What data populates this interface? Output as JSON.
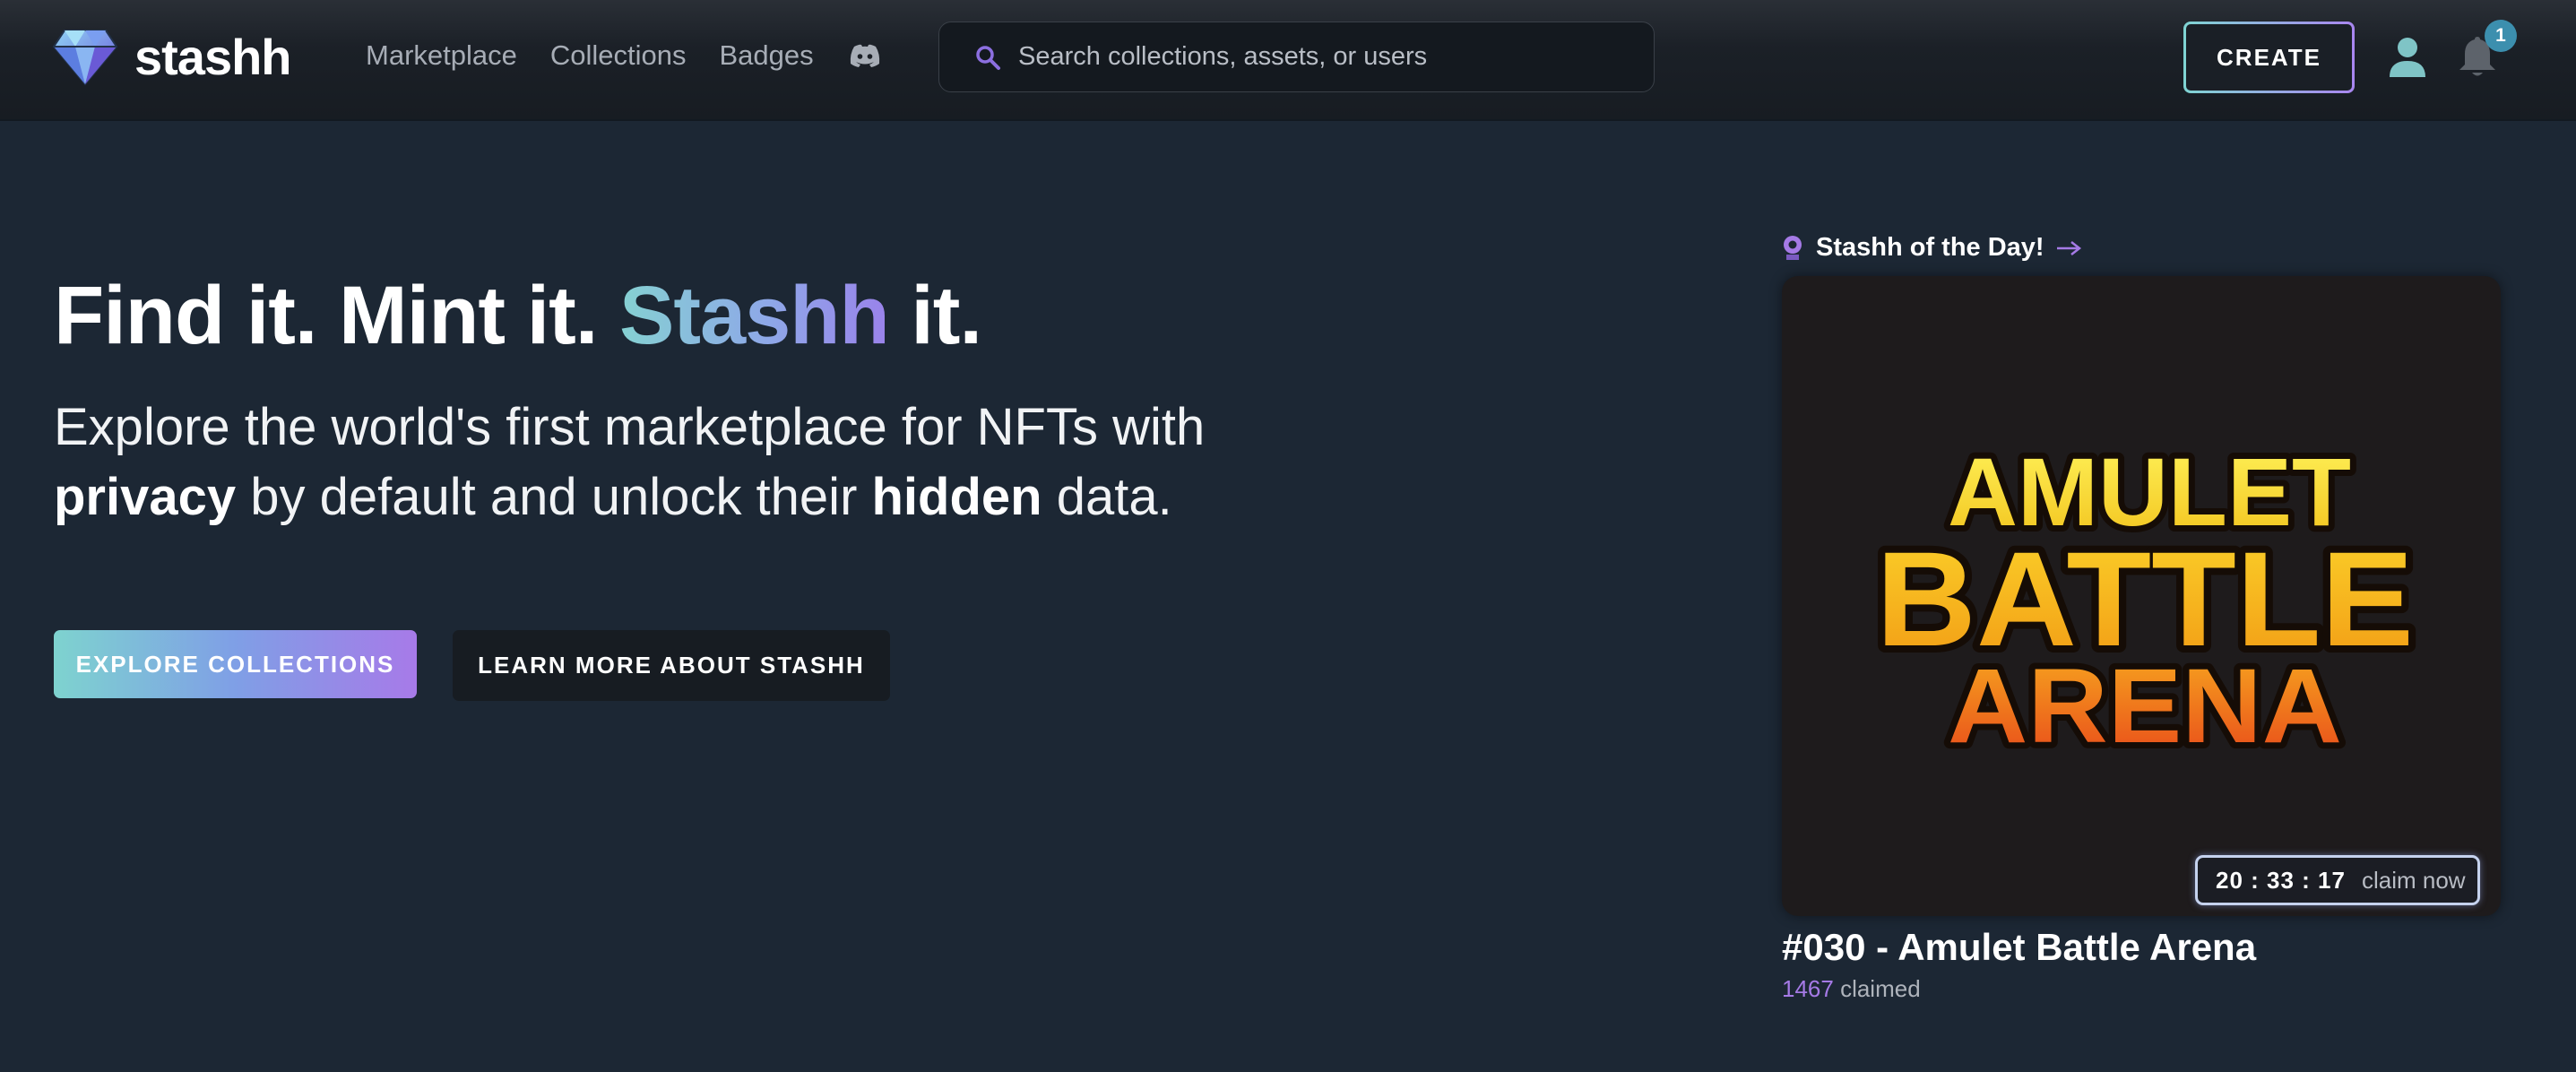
{
  "brand": {
    "name": "stashh"
  },
  "nav": {
    "items": [
      "Marketplace",
      "Collections",
      "Badges"
    ]
  },
  "search": {
    "placeholder": "Search collections, assets, or users"
  },
  "header": {
    "create_label": "CREATE",
    "notification_count": "1"
  },
  "hero": {
    "title_part1": "Find it. Mint it. ",
    "title_highlight": "Stashh",
    "title_part2": " it.",
    "subtitle_part1": "Explore the world's first marketplace for NFTs with ",
    "subtitle_bold1": "privacy",
    "subtitle_part2": " by default and unlock their ",
    "subtitle_bold2": "hidden",
    "subtitle_part3": " data.",
    "explore_label": "EXPLORE COLLECTIONS",
    "learn_label": "LEARN MORE ABOUT STASHH"
  },
  "sotd": {
    "heading": "Stashh of the Day!",
    "art_lines": [
      "AMULET",
      "BATTLE",
      "ARENA"
    ],
    "timer": "20 : 33 : 17",
    "claim_label": "claim now",
    "title": "#030 - Amulet Battle Arena",
    "claimed_count": "1467",
    "claimed_label": " claimed"
  },
  "colors": {
    "background": "#1c2734",
    "accent_teal": "#7fd4d3",
    "accent_purple": "#a77ae8",
    "badge": "#3c8fae"
  },
  "icons": [
    "diamond-logo-icon",
    "discord-icon",
    "search-icon",
    "user-icon",
    "bell-icon",
    "pin-icon",
    "arrow-right-icon"
  ]
}
